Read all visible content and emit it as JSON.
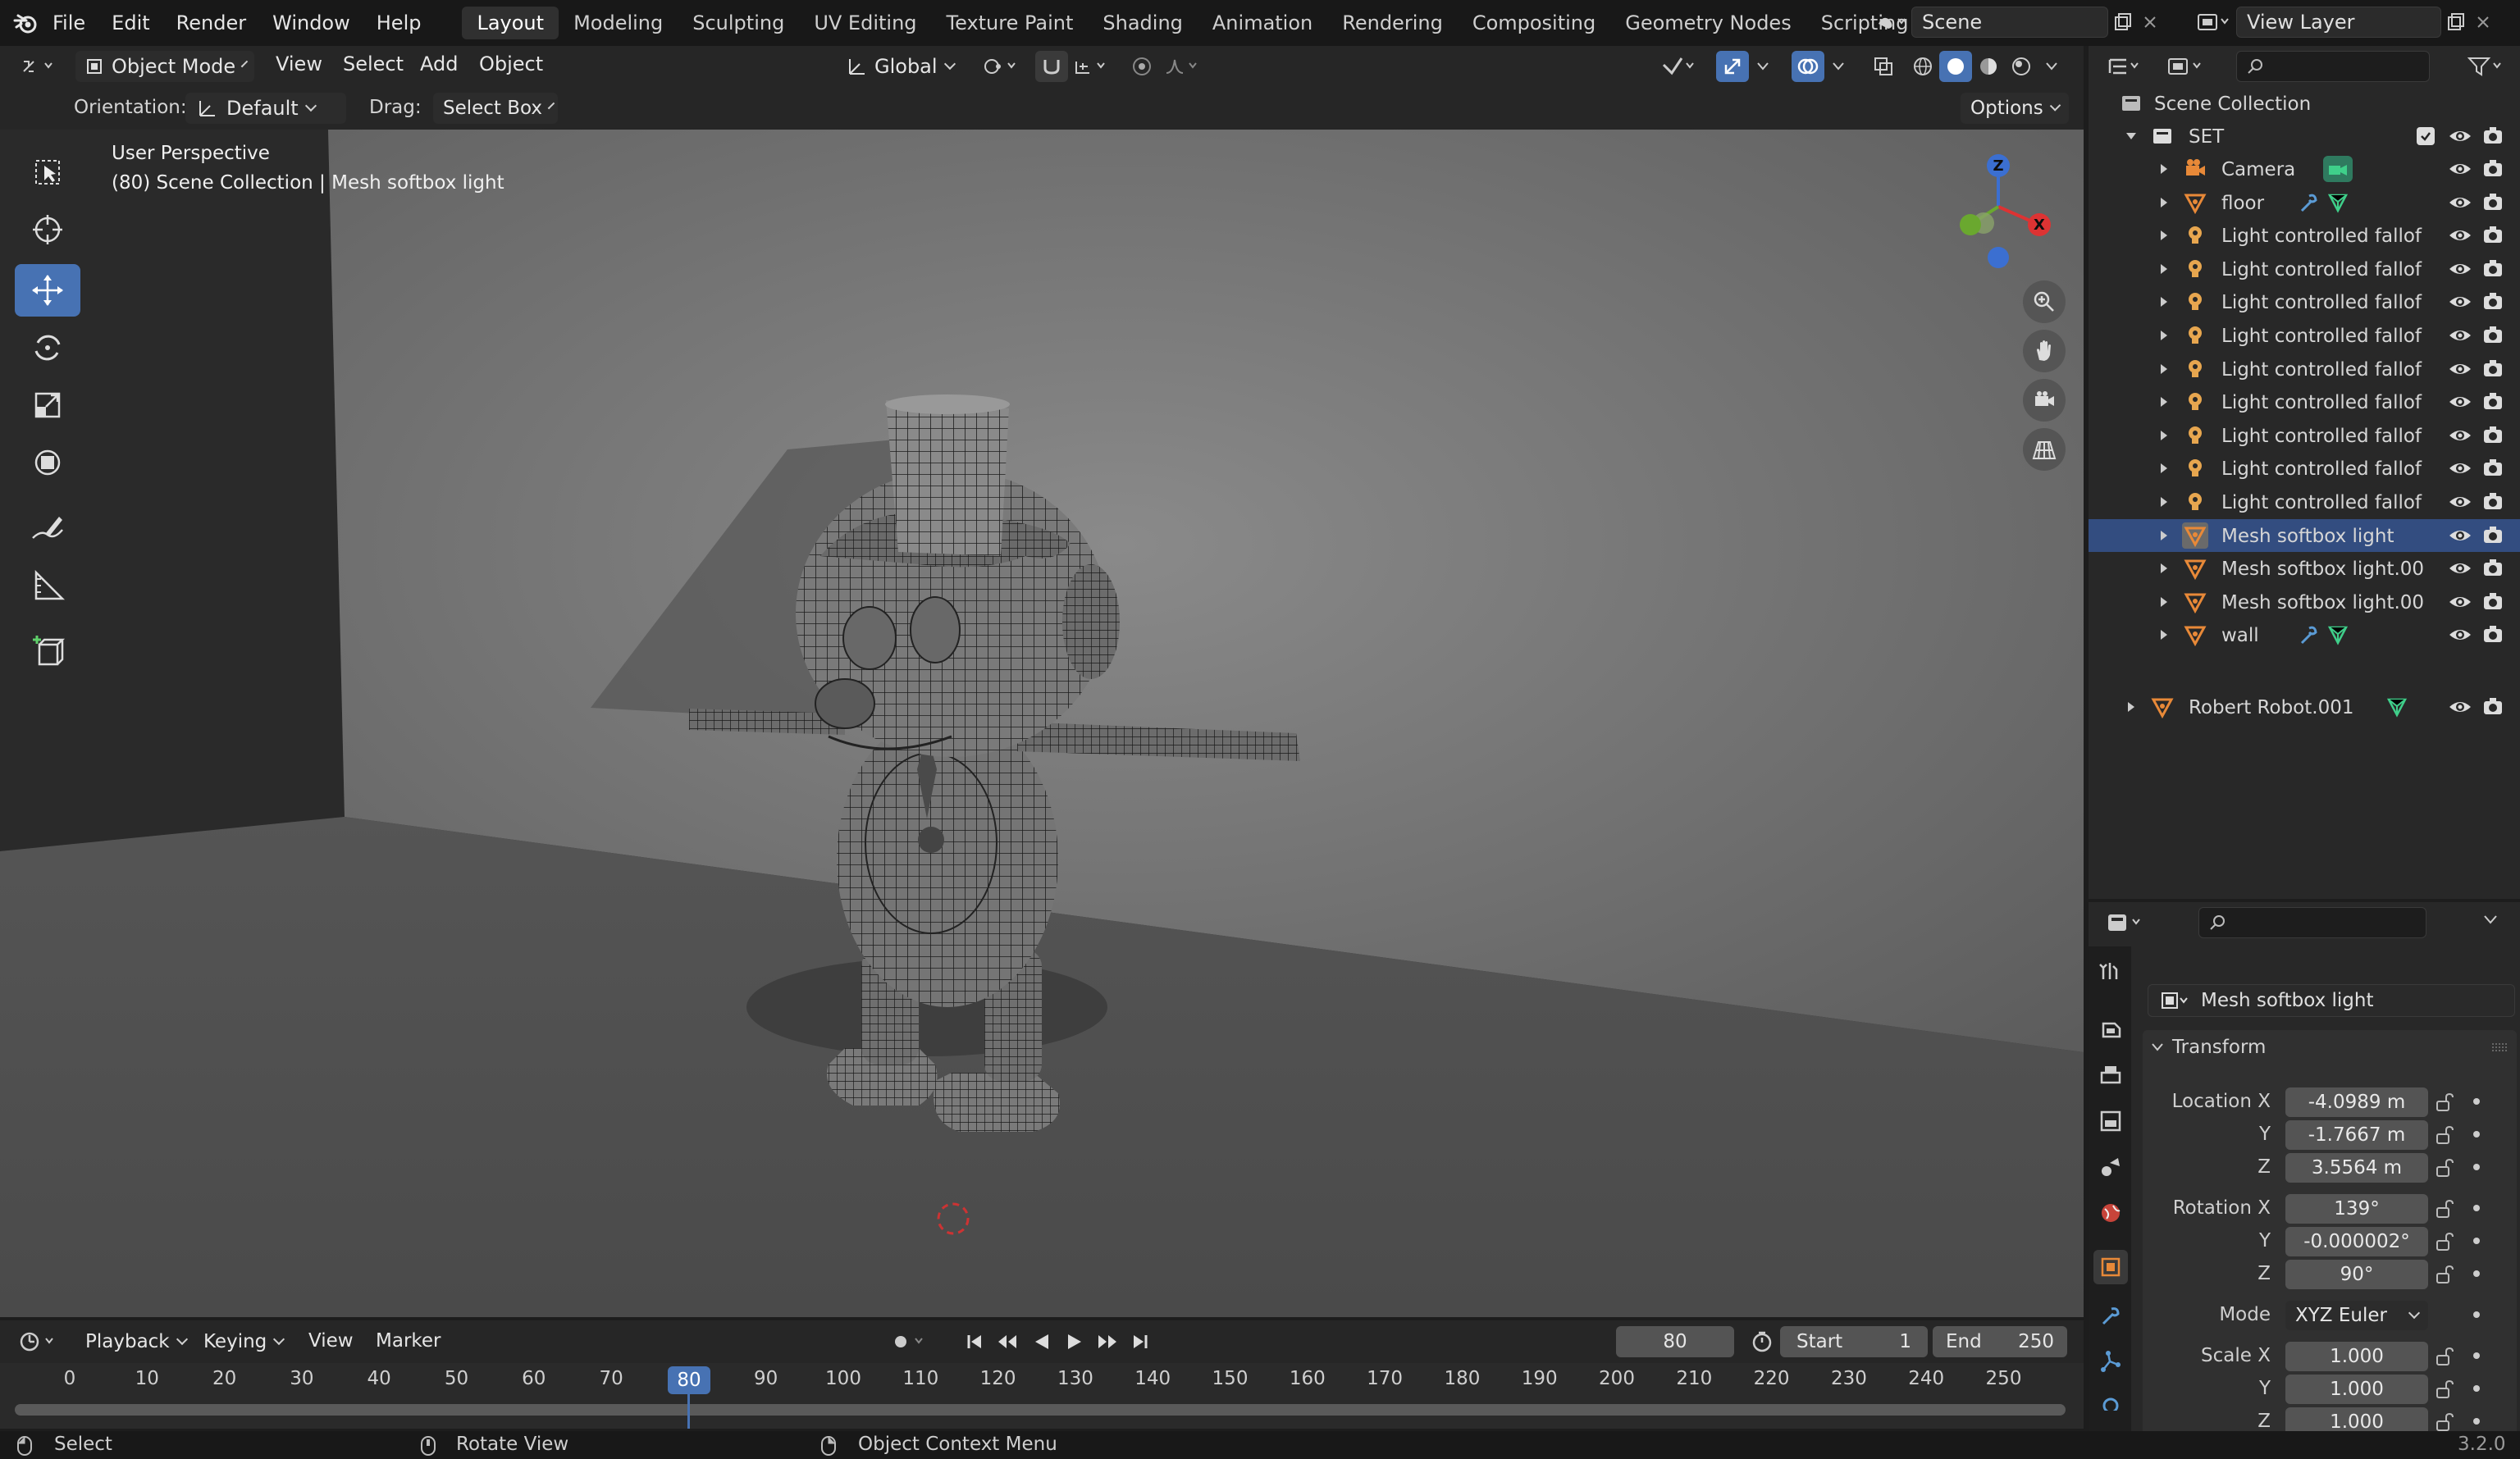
{
  "menubar": {
    "menus": [
      "File",
      "Edit",
      "Render",
      "Window",
      "Help"
    ],
    "workspaces": [
      "Layout",
      "Modeling",
      "Sculpting",
      "UV Editing",
      "Texture Paint",
      "Shading",
      "Animation",
      "Rendering",
      "Compositing",
      "Geometry Nodes",
      "Scripting"
    ],
    "active_workspace": "Layout",
    "add_tab": "+",
    "scene_label": "Scene",
    "view_layer_label": "View Layer"
  },
  "viewport_header": {
    "mode": "Object Mode",
    "menus": [
      "View",
      "Select",
      "Add",
      "Object"
    ],
    "transform_orientation": "Global"
  },
  "viewport_subheader": {
    "orientation_label": "Orientation:",
    "orientation_value": "Default",
    "drag_label": "Drag:",
    "drag_value": "Select Box",
    "options": "Options"
  },
  "viewport": {
    "perspective": "User Perspective",
    "collection_info": "(80) Scene Collection | Mesh softbox light",
    "gizmo_axes": [
      "Z",
      "X"
    ]
  },
  "outliner": {
    "root": "Scene Collection",
    "collection": "SET",
    "items": [
      {
        "name": "Camera",
        "type": "camera"
      },
      {
        "name": "floor",
        "type": "mesh"
      },
      {
        "name": "Light controlled fallof",
        "type": "light"
      },
      {
        "name": "Light controlled fallof",
        "type": "light"
      },
      {
        "name": "Light controlled fallof",
        "type": "light"
      },
      {
        "name": "Light controlled fallof",
        "type": "light"
      },
      {
        "name": "Light controlled fallof",
        "type": "light"
      },
      {
        "name": "Light controlled fallof",
        "type": "light"
      },
      {
        "name": "Light controlled fallof",
        "type": "light"
      },
      {
        "name": "Light controlled fallof",
        "type": "light"
      },
      {
        "name": "Light controlled fallof",
        "type": "light"
      },
      {
        "name": "Mesh softbox light",
        "type": "mesh"
      },
      {
        "name": "Mesh softbox light.00",
        "type": "mesh"
      },
      {
        "name": "Mesh softbox light.00",
        "type": "mesh"
      },
      {
        "name": "wall",
        "type": "mesh"
      }
    ],
    "root_object": "Robert Robot.001"
  },
  "properties": {
    "object_name": "Mesh softbox light",
    "transform_header": "Transform",
    "location_label": "Location X",
    "location": [
      "-4.0989 m",
      "-1.7667 m",
      "3.5564 m"
    ],
    "rotation_label": "Rotation X",
    "rotation": [
      "139°",
      "-0.000002°",
      "90°"
    ],
    "axis_y": "Y",
    "axis_z": "Z",
    "mode_label": "Mode",
    "mode_value": "XYZ Euler",
    "scale_label": "Scale X",
    "scale": [
      "1.000",
      "1.000",
      "1.000"
    ]
  },
  "timeline": {
    "menus": [
      "Playback",
      "Keying",
      "View",
      "Marker"
    ],
    "current_frame": "80",
    "start_label": "Start",
    "start": "1",
    "end_label": "End",
    "end": "250",
    "frames": [
      "0",
      "10",
      "20",
      "30",
      "40",
      "50",
      "60",
      "70",
      "80",
      "90",
      "100",
      "110",
      "120",
      "130",
      "140",
      "150",
      "160",
      "170",
      "180",
      "190",
      "200",
      "210",
      "220",
      "230",
      "240",
      "250"
    ]
  },
  "statusbar": {
    "select": "Select",
    "rotate_view": "Rotate View",
    "context_menu": "Object Context Menu",
    "version": "3.2.0"
  },
  "colors": {
    "accent": "#4772b3",
    "light_icon": "#e7a64f",
    "mesh_icon": "#e88938",
    "modifier_icon": "#5b9bd5",
    "data_icon": "#3fcf8a"
  }
}
